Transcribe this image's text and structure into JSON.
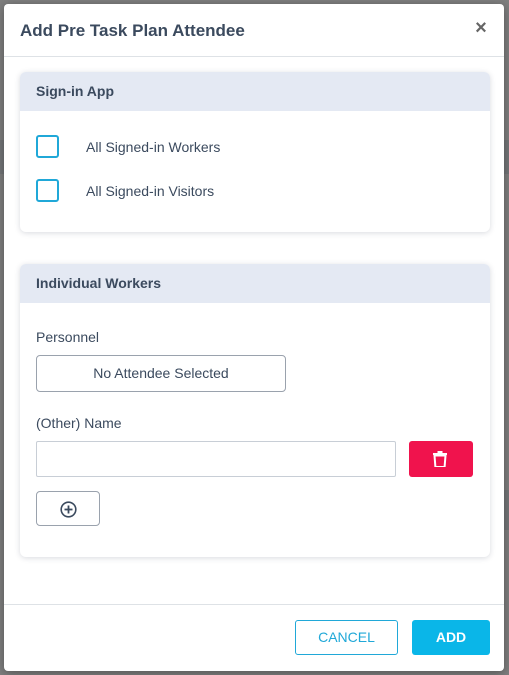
{
  "modal": {
    "title": "Add Pre Task Plan Attendee",
    "close_icon": "close-icon"
  },
  "signin_section": {
    "title": "Sign-in App",
    "options": [
      {
        "label": "All Signed-in Workers",
        "checked": false
      },
      {
        "label": "All Signed-in Visitors",
        "checked": false
      }
    ]
  },
  "workers_section": {
    "title": "Individual Workers",
    "personnel_label": "Personnel",
    "personnel_button": "No Attendee Selected",
    "other_name_label": "(Other) Name",
    "other_name_value": "",
    "delete_icon": "trash-icon",
    "add_icon": "plus-circle-icon"
  },
  "footer": {
    "cancel_label": "CANCEL",
    "add_label": "ADD"
  },
  "colors": {
    "accent": "#20a8d8",
    "primary_button": "#0ab6e8",
    "danger": "#f0134d",
    "section_header_bg": "#e4e9f3"
  }
}
